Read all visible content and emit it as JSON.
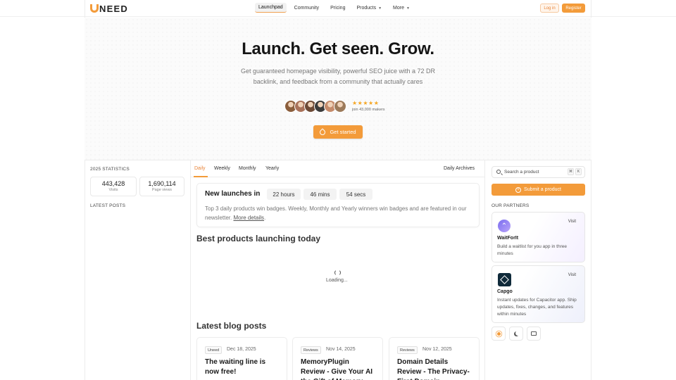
{
  "header": {
    "logo_text": "NEED",
    "nav": [
      {
        "label": "Launchpad",
        "active": true
      },
      {
        "label": "Community"
      },
      {
        "label": "Pricing"
      },
      {
        "label": "Products",
        "dropdown": true
      },
      {
        "label": "More",
        "dropdown": true
      }
    ],
    "login": "Log in",
    "register": "Register"
  },
  "hero": {
    "title": "Launch. Get seen. Grow.",
    "subtitle": "Get guaranteed homepage visibility, powerful SEO juice with a 72 DR backlink, and feedback from a community that actually cares",
    "stars": "★★★★★",
    "makers": "join 43,000 makers",
    "cta": "Get started",
    "avatar_colors": [
      "#8b5e3c",
      "#a9725a",
      "#6d4a36",
      "#3b3b3b",
      "#c58b6b",
      "#9c7a5a"
    ]
  },
  "stats": {
    "title": "2025 STATISTICS",
    "cards": [
      {
        "value": "443,428",
        "label": "Visits"
      },
      {
        "value": "1,690,114",
        "label": "Page views"
      }
    ],
    "latest_posts": "LATEST POSTS"
  },
  "tabs": {
    "items": [
      "Daily",
      "Weekly",
      "Monthly",
      "Yearly"
    ],
    "active": "Daily",
    "archives": "Daily Archives"
  },
  "launch_card": {
    "title": "New launches in",
    "timers": [
      "22 hours",
      "46 mins",
      "54 secs"
    ],
    "description": "Top 3 daily products win badges. Weekly, Monthly and Yearly winners win badges and are featured in our newsletter.",
    "more": "More details",
    "end": "."
  },
  "best_products": {
    "title": "Best products launching today",
    "loading": "Loading..."
  },
  "blog": {
    "title": "Latest blog posts",
    "posts": [
      {
        "tag": "Uneed",
        "date": "Dec 18, 2025",
        "title": "The waiting line is now free!"
      },
      {
        "tag": "Reviews",
        "date": "Nov 14, 2025",
        "title": "MemoryPlugin Review - Give Your AI the Gift of Memory"
      },
      {
        "tag": "Reviews",
        "date": "Nov 12, 2025",
        "title": "Domain Details Review - The Privacy-First Domain"
      }
    ]
  },
  "sidebar": {
    "search_placeholder": "Search a product",
    "kbd": [
      "⌘",
      "K"
    ],
    "submit": "Submit a product",
    "partners_title": "OUR PARTNERS",
    "partners": [
      {
        "name": "WaitForIt",
        "description": "Build a waitlist for you app in three minutes",
        "visit": "Visit"
      },
      {
        "name": "Capgo",
        "description": "Instant updates for Capacitor app. Ship updates, fixes, changes, and features within minutes",
        "visit": "Visit"
      }
    ],
    "theme_buttons": [
      "sun-icon",
      "moon-icon",
      "monitor-icon"
    ]
  }
}
